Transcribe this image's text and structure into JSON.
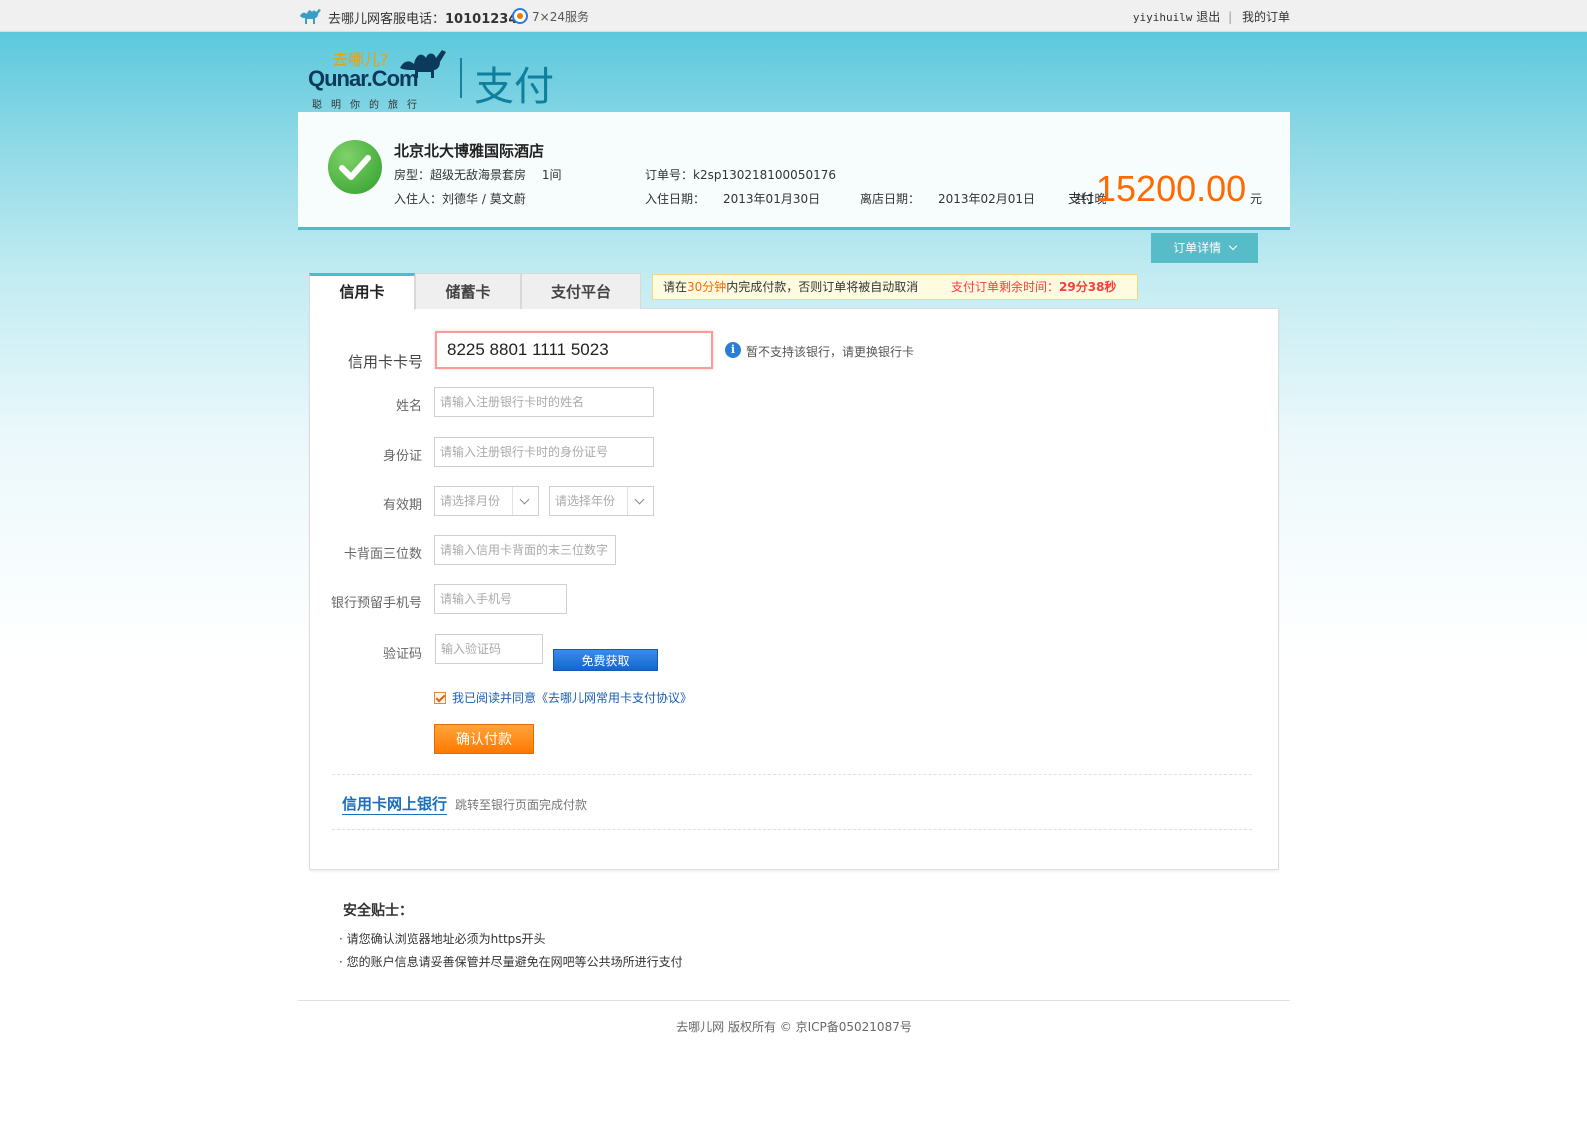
{
  "topbar": {
    "hotline_label": "去哪儿网客服电话：",
    "hotline_number": "10101234",
    "service": "7×24服务",
    "username": "yiyihuilw",
    "logout": "退出",
    "my_orders": "我的订单",
    "separator": "|"
  },
  "header": {
    "logo_tagline": "去哪儿?",
    "logo_brand": "Qunar.Com",
    "logo_slogan": "聪明你的旅行",
    "page_title": "支付"
  },
  "order": {
    "hotel_name": "北京北大博雅国际酒店",
    "room_label": "房型：",
    "room_type": "超级无敌海景套房",
    "room_count": "1间",
    "guest_label": "入住人：",
    "guests": "刘德华 / 莫文蔚",
    "order_no_label": "订单号：",
    "order_no": "k2sp130218100050176",
    "checkin_label": "入住日期：",
    "checkin": "2013年01月30日",
    "checkout_label": "离店日期：",
    "checkout": "2013年02月01日",
    "nights": "共1晚",
    "pay_label": "支付",
    "amount": "15200.00",
    "currency": "元",
    "detail_button": "订单详情"
  },
  "tabs": [
    {
      "label": "信用卡",
      "active": true
    },
    {
      "label": "储蓄卡",
      "active": false
    },
    {
      "label": "支付平台",
      "active": false
    }
  ],
  "notice": {
    "prefix": "请在",
    "time_limit": "30分钟",
    "suffix": "内完成付款，否则订单将被自动取消",
    "remain_label": "支付订单剩余时间：",
    "remain_time": "29分38秒"
  },
  "form": {
    "card_number_label": "信用卡卡号",
    "card_number_value": "8225 8801 1111 5023",
    "card_hint": "暂不支持该银行，请更换银行卡",
    "name_label": "姓名",
    "name_placeholder": "请输入注册银行卡时的姓名",
    "id_label": "身份证",
    "id_placeholder": "请输入注册银行卡时的身份证号",
    "expiry_label": "有效期",
    "month_placeholder": "请选择月份",
    "year_placeholder": "请选择年份",
    "cvv_label": "卡背面三位数",
    "cvv_placeholder": "请输入信用卡背面的末三位数字",
    "phone_label": "银行预留手机号",
    "phone_placeholder": "请输入手机号",
    "code_label": "验证码",
    "code_placeholder": "输入验证码",
    "get_code_button": "免费获取",
    "agree_text": "我已阅读并同意《去哪儿网常用卡支付协议》",
    "agree_checked": true,
    "confirm_button": "确认付款",
    "online_bank_link": "信用卡网上银行",
    "online_bank_desc": "跳转至银行页面完成付款"
  },
  "tips": {
    "title": "安全贴士：",
    "lines": [
      "· 请您确认浏览器地址必须为https开头",
      "· 您的账户信息请妥善保管并尽量避免在网吧等公共场所进行支付"
    ]
  },
  "footer": {
    "copyright": "去哪儿网 版权所有 © 京ICP备05021087号"
  },
  "colors": {
    "accent": "#4bbdc9",
    "amount": "#ff6a00",
    "confirm": "#ff7800",
    "link": "#1a6fb8"
  }
}
